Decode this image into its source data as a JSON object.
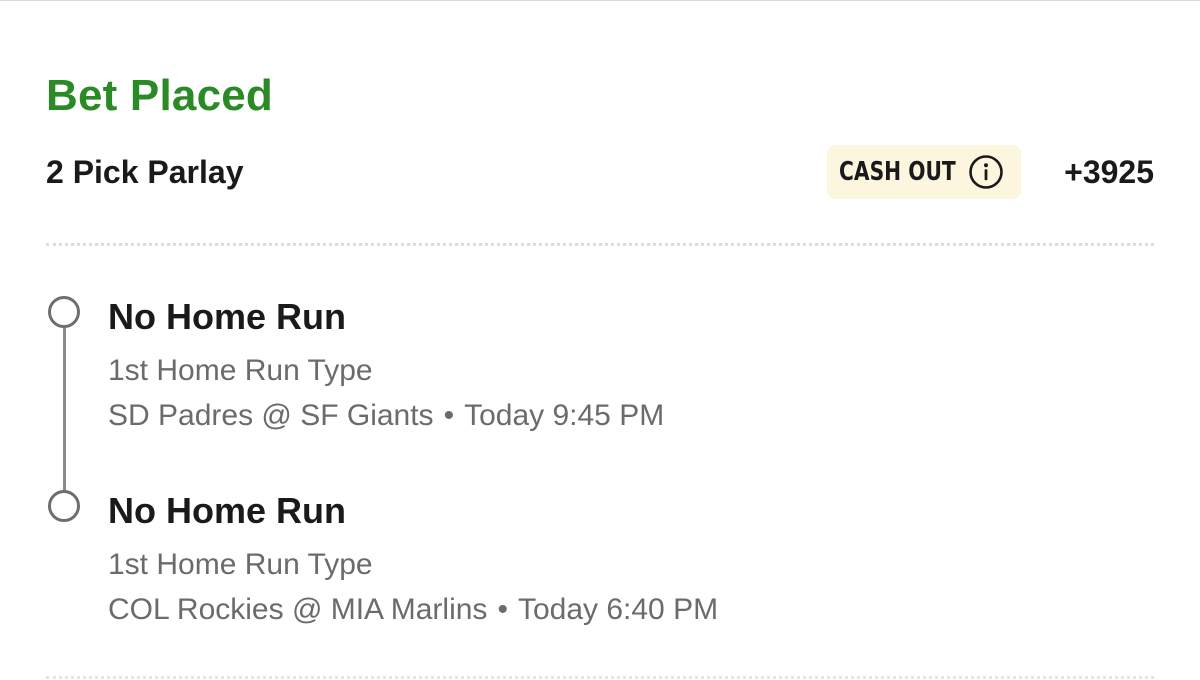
{
  "header": {
    "status": "Bet Placed",
    "status_color": "#2a8a26",
    "bet_type": "2 Pick Parlay",
    "cashout_label": "CASH OUT",
    "cashout_bg": "#fdf6df",
    "info_icon": "info-circle-icon",
    "odds": "+3925"
  },
  "legs": [
    {
      "selection": "No Home Run",
      "market": "1st Home Run Type",
      "matchup": "SD Padres @ SF Giants",
      "separator": "•",
      "time": "Today 9:45 PM"
    },
    {
      "selection": "No Home Run",
      "market": "1st Home Run Type",
      "matchup": "COL Rockies @ MIA Marlins",
      "separator": "•",
      "time": "Today 6:40 PM"
    }
  ]
}
